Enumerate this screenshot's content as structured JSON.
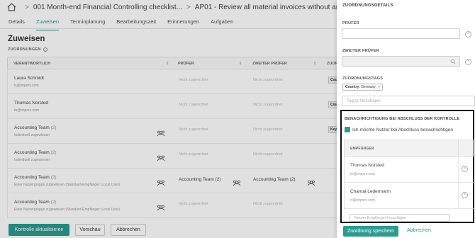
{
  "header": {
    "breadcrumb_1": "001 Month-end Financial Controlling checklist...",
    "breadcrumb_sep": ">",
    "breadcrumb_2": "AP01 - Review all material invoices without an..."
  },
  "tabs": [
    "Details",
    "Zuweisen",
    "Terminplanung",
    "Bearbeitungszeit",
    "Erinnerungen",
    "Aufgaben"
  ],
  "main": {
    "title": "Zuweisen",
    "section_label": "ZUORDNUNGEN",
    "info_icon": "i",
    "columns": [
      "VERANTWORTLICH",
      "PRÜFER",
      "ZWEITER PRÜFER",
      "ZUOR"
    ],
    "sort_glyph": "⇕",
    "rows": [
      {
        "name": "Laura Schmidt",
        "count": "",
        "sub": "ls@impers.com",
        "pruefer": "Nicht zugeordnet",
        "zweiter": "Nicht zugeordnet",
        "tag": "Cou",
        "group": false,
        "pruefer_group": false,
        "zweiter_group": false
      },
      {
        "name": "Thomas Norsted",
        "count": "",
        "sub": "tn@impers.com",
        "pruefer": "Nicht zugeordnet",
        "zweiter": "Nicht zugeordnet",
        "tag": "Cou",
        "group": false,
        "pruefer_group": false,
        "zweiter_group": false
      },
      {
        "name": "Accounting Team",
        "count": "(2)",
        "sub": "Individuell zugewiesen",
        "pruefer": "Nicht zugeordnet",
        "zweiter": "Nicht zugeordnet",
        "tag": "Key",
        "group": true,
        "pruefer_group": false,
        "zweiter_group": false
      },
      {
        "name": "Accounting Team",
        "count": "(2)",
        "sub": "Individuell zugewiesen",
        "pruefer": "Nicht zugeordnet",
        "zweiter": "Nicht zugeordnet",
        "tag": "",
        "group": true,
        "pruefer_group": false,
        "zweiter_group": false
      },
      {
        "name": "Accounting Team",
        "count": "(2)",
        "sub": "Einer Nutzergruppe zugewiesen (Standard-Empfänger: Local User)",
        "pruefer": "Accounting Team (2)",
        "zweiter": "Accounting Team (2)",
        "tag": "",
        "group": true,
        "pruefer_group": true,
        "zweiter_group": true
      },
      {
        "name": "Accounting Team",
        "count": "(2)",
        "sub": "Einer Nutzergruppe zugewiesen (Standard-Empfänger: Local User)",
        "pruefer": "Nicht zugeordnet",
        "zweiter": "Nicht zugeordnet",
        "tag": "",
        "group": true,
        "pruefer_group": false,
        "zweiter_group": false
      }
    ],
    "buttons": {
      "update": "Kontrolle aktualisieren",
      "preview": "Vorschau",
      "cancel": "Abbrechen"
    }
  },
  "drawer": {
    "title": "ZUORDNUNGSDETAILS",
    "pruefer_label": "PRÜFER",
    "pruefer_value": "",
    "zweiter_label": "ZWEITER PRÜFER",
    "zweiter_value": "",
    "tags_label": "ZUORDNUNGSTAGS",
    "tag_chip_key": "Country:",
    "tag_chip_value": "Germany",
    "tag_chip_remove": "×",
    "tags_placeholder": "Tag(s) hinzufügen",
    "clear_glyph": "×",
    "notification": {
      "title": "BENACHRICHTIGUNG BEI ABSCHLUSS DER KONTROLLE",
      "checkbox_label": "Ich möchte Nutzer bei Abschluss benachrichtigen",
      "checked": true,
      "recipients_header": "EMPFÄNGER",
      "recipients": [
        {
          "name": "Thomas Norsted",
          "email": "tn@impers.com"
        },
        {
          "name": "Chantal Ledermann",
          "email": "cl@impers.com"
        }
      ],
      "add_placeholder": "Neuen Empfänger hinzufügen"
    },
    "save_label": "Zuordnung speichern",
    "cancel_label": "Abbrechen"
  },
  "colors": {
    "accent": "#2a9d8f",
    "highlight_border": "#111111"
  }
}
